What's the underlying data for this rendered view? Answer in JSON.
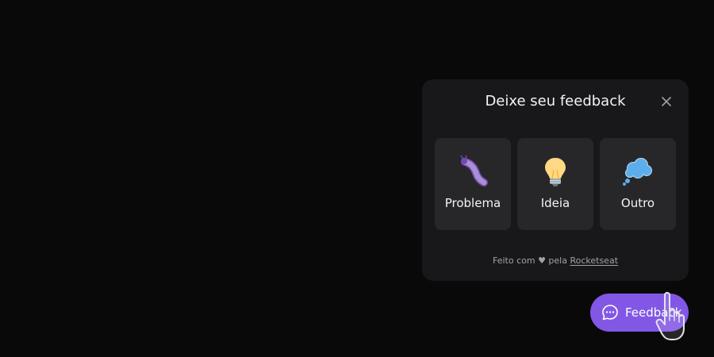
{
  "widget": {
    "title": "Deixe seu feedback",
    "close_icon": "close-icon",
    "options": [
      {
        "label": "Problema",
        "icon": "bug-icon"
      },
      {
        "label": "Ideia",
        "icon": "lightbulb-icon"
      },
      {
        "label": "Outro",
        "icon": "thought-balloon-icon"
      }
    ],
    "footer": {
      "prefix": "Feito com ♥ pela",
      "link": "Rocketseat"
    }
  },
  "feedback_button": {
    "label": "Feedback",
    "icon": "chat-bubble-icon"
  },
  "cursor": "hand-pointer-icon",
  "colors": {
    "background": "#09090a",
    "panel": "#18181b",
    "card": "#27272a",
    "brand": "#8257e6",
    "text": "#f4f4f5",
    "muted": "#a1a1aa"
  }
}
